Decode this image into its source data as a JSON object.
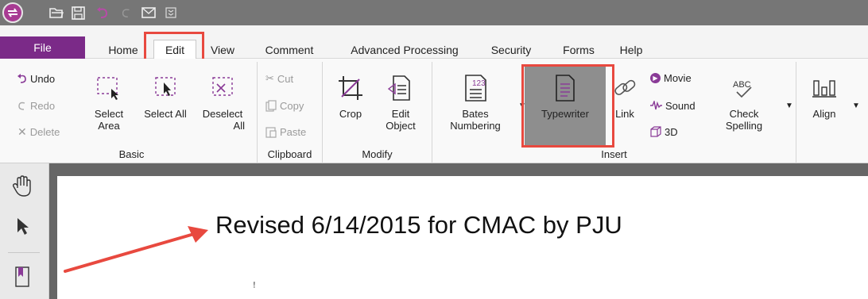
{
  "quick_access": {
    "icons": [
      "app-logo-icon",
      "open-folder-icon",
      "save-icon",
      "undo-icon",
      "redo-icon",
      "email-icon",
      "customize-icon"
    ]
  },
  "menu": {
    "tabs": [
      "File",
      "Home",
      "Edit",
      "View",
      "Comment",
      "Advanced Processing",
      "Security",
      "Forms",
      "Help"
    ],
    "active": "Edit",
    "colors": {
      "file_bg": "#7b2a88",
      "highlight": "#e8493f"
    }
  },
  "ribbon": {
    "basic": {
      "label": "Basic",
      "undo": "Undo",
      "redo": "Redo",
      "delete": "Delete",
      "select_area": [
        "Select",
        "Area"
      ],
      "select_all": "Select All",
      "deselect_all": [
        "Deselect",
        "All"
      ]
    },
    "clipboard": {
      "label": "Clipboard",
      "cut": "Cut",
      "copy": "Copy",
      "paste": "Paste"
    },
    "modify": {
      "label": "Modify",
      "crop": "Crop",
      "edit_object": [
        "Edit",
        "Object"
      ]
    },
    "insert": {
      "label": "Insert",
      "bates": [
        "Bates",
        "Numbering"
      ],
      "typewriter": "Typewriter",
      "link": "Link",
      "movie": "Movie",
      "sound": "Sound",
      "three_d": "3D",
      "check_spelling": [
        "Check",
        "Spelling"
      ],
      "abc": "ABC"
    },
    "align": {
      "label": "Align"
    }
  },
  "document": {
    "text": "Revised 6/14/2015 for CMAC by PJU"
  }
}
